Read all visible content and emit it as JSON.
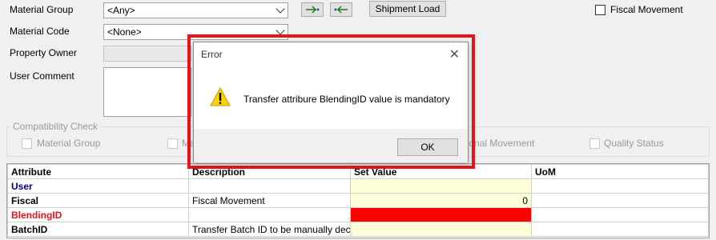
{
  "form": {
    "material_group_label": "Material Group",
    "material_group_value": "<Any>",
    "material_code_label": "Material Code",
    "material_code_value": "<None>",
    "property_owner_label": "Property Owner",
    "user_comment_label": "User Comment",
    "shipment_load_label": "Shipment Load",
    "fiscal_movement_label": "Fiscal Movement"
  },
  "compat": {
    "title": "Compatibility Check",
    "material_group": "Material Group",
    "ma_partial": "Ma",
    "seasonal_movement": "Seasonal Movement",
    "quality_status": "Quality Status"
  },
  "grid": {
    "headers": [
      "Attribute",
      "Description",
      "Set Value",
      "UoM"
    ],
    "rows": [
      {
        "attribute": "User",
        "description": "",
        "value": "",
        "uom": ""
      },
      {
        "attribute": "Fiscal",
        "description": "Fiscal Movement",
        "value": "0",
        "uom": ""
      },
      {
        "attribute": "BlendingID",
        "description": "",
        "value": "",
        "uom": ""
      },
      {
        "attribute": "BatchID",
        "description": "Transfer Batch ID to be manually decla...",
        "value": "",
        "uom": ""
      }
    ]
  },
  "dialog": {
    "title": "Error",
    "message": "Transfer attribure BlendingID value is mandatory",
    "ok_label": "OK",
    "icon": "warning-icon"
  },
  "colors": {
    "highlight": "#e8141a",
    "error_cell": "#ff0000",
    "editable_cell": "#fefed8",
    "user_attr": "#00008b",
    "blending_attr": "#e8141a"
  }
}
